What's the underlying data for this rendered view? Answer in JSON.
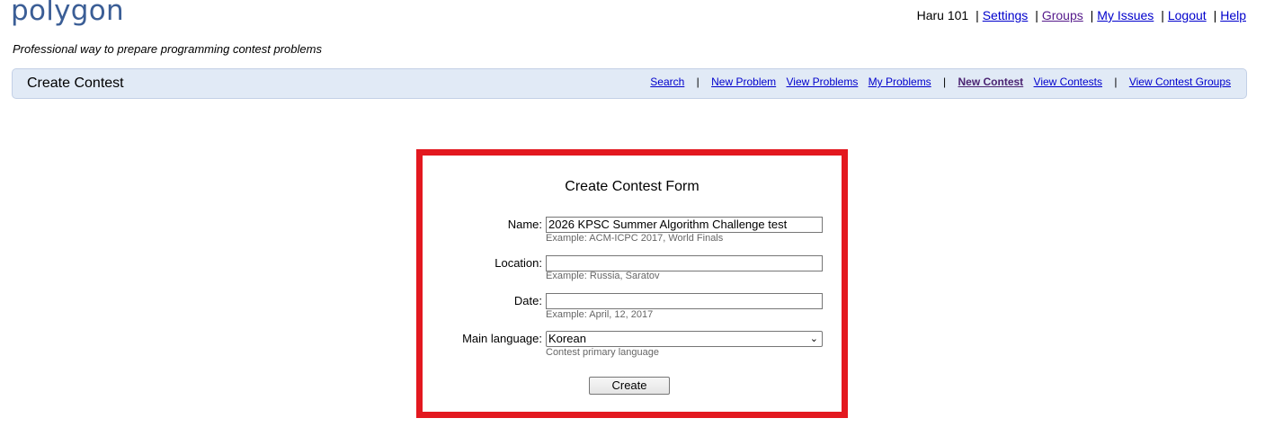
{
  "app": {
    "logo": "polygon",
    "tagline": "Professional way to prepare programming contest problems"
  },
  "user_nav": {
    "username": "Haru 101",
    "links": [
      "Settings",
      "Groups",
      "My Issues",
      "Logout",
      "Help"
    ]
  },
  "header": {
    "title": "Create Contest",
    "menu": [
      "Search",
      "New Problem",
      "View Problems",
      "My Problems",
      "New Contest",
      "View Contests",
      "View Contest Groups"
    ],
    "active": "New Contest"
  },
  "form": {
    "title": "Create Contest Form",
    "name_label": "Name:",
    "name_value": "2026 KPSC Summer Algorithm Challenge test",
    "name_hint": "Example: ACM-ICPC 2017, World Finals",
    "location_label": "Location:",
    "location_value": "",
    "location_hint": "Example: Russia, Saratov",
    "date_label": "Date:",
    "date_value": "",
    "date_hint": "Example: April, 12, 2017",
    "language_label": "Main language:",
    "language_value": "Korean",
    "language_hint": "Contest primary language",
    "submit_label": "Create"
  },
  "colors": {
    "highlight": "#e3181f",
    "header_bar": "#e1eaf6",
    "logo": "#3b5e96",
    "link": "#0000cc"
  }
}
